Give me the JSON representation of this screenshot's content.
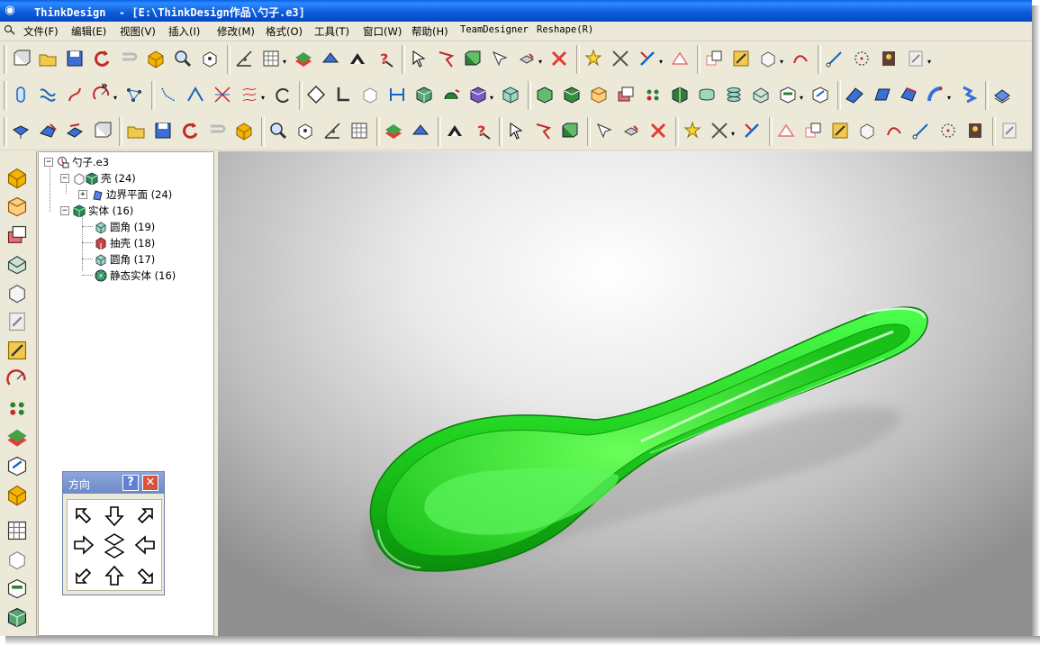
{
  "window": {
    "title": "ThinkDesign  - [E:\\ThinkDesign作品\\勺子.e3]",
    "colors": {
      "title_bar": "#0b5ad8",
      "chrome": "#ece9d8",
      "spoon": "#1fd01f"
    }
  },
  "menu": {
    "items": [
      "文件(F)",
      "编辑(E)",
      "视图(V)",
      "插入(I)",
      "修改(M)",
      "格式(O)",
      "工具(T)",
      "窗口(W)",
      "帮助(H)",
      "TeamDesigner",
      "Reshape(R)"
    ]
  },
  "tree": {
    "root": "勺子.e3",
    "shell": "壳 (24)",
    "boundary_plane": "边界平面 (24)",
    "solid": "实体 (16)",
    "fillet1": "圆角 (19)",
    "shell_op": "抽壳 (18)",
    "fillet2": "圆角 (17)",
    "static_solid": "静态实体 (16)"
  },
  "direction_panel": {
    "title": "方向",
    "help_label": "?",
    "close_label": "✕"
  },
  "toolbar_overflow_label": "»"
}
